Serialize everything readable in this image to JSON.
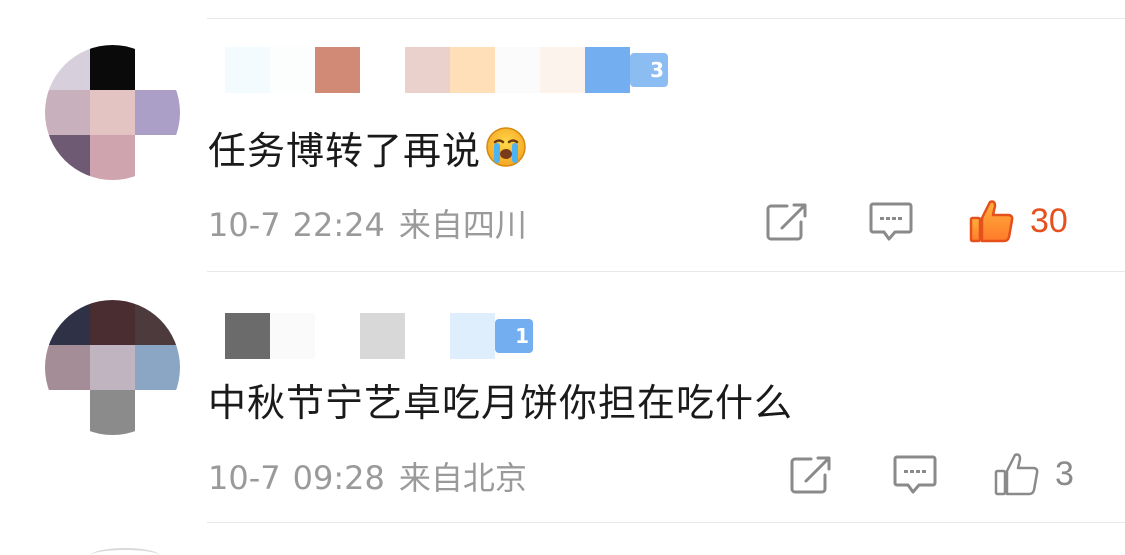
{
  "comments": [
    {
      "text": "任务博转了再说",
      "emoji": "crying-face",
      "date": "10-7",
      "time": "22:24",
      "location": "来自四川",
      "like_count": "30",
      "liked": true,
      "level_badge": "3"
    },
    {
      "text": "中秋节宁艺卓吃月饼你担在吃什么",
      "date": "10-7",
      "time": "09:28",
      "location": "来自北京",
      "like_count": "3",
      "liked": false,
      "level_badge": "1"
    }
  ],
  "icons": {
    "share": "share-icon",
    "reply": "comment-icon",
    "like": "thumbs-up-icon"
  },
  "colors": {
    "like_active": "#e5501d",
    "icon_gray": "#8a8a8a",
    "meta_gray": "#9a9a9a",
    "text": "#1a1a1a",
    "badge_blue": "#73aff0"
  }
}
